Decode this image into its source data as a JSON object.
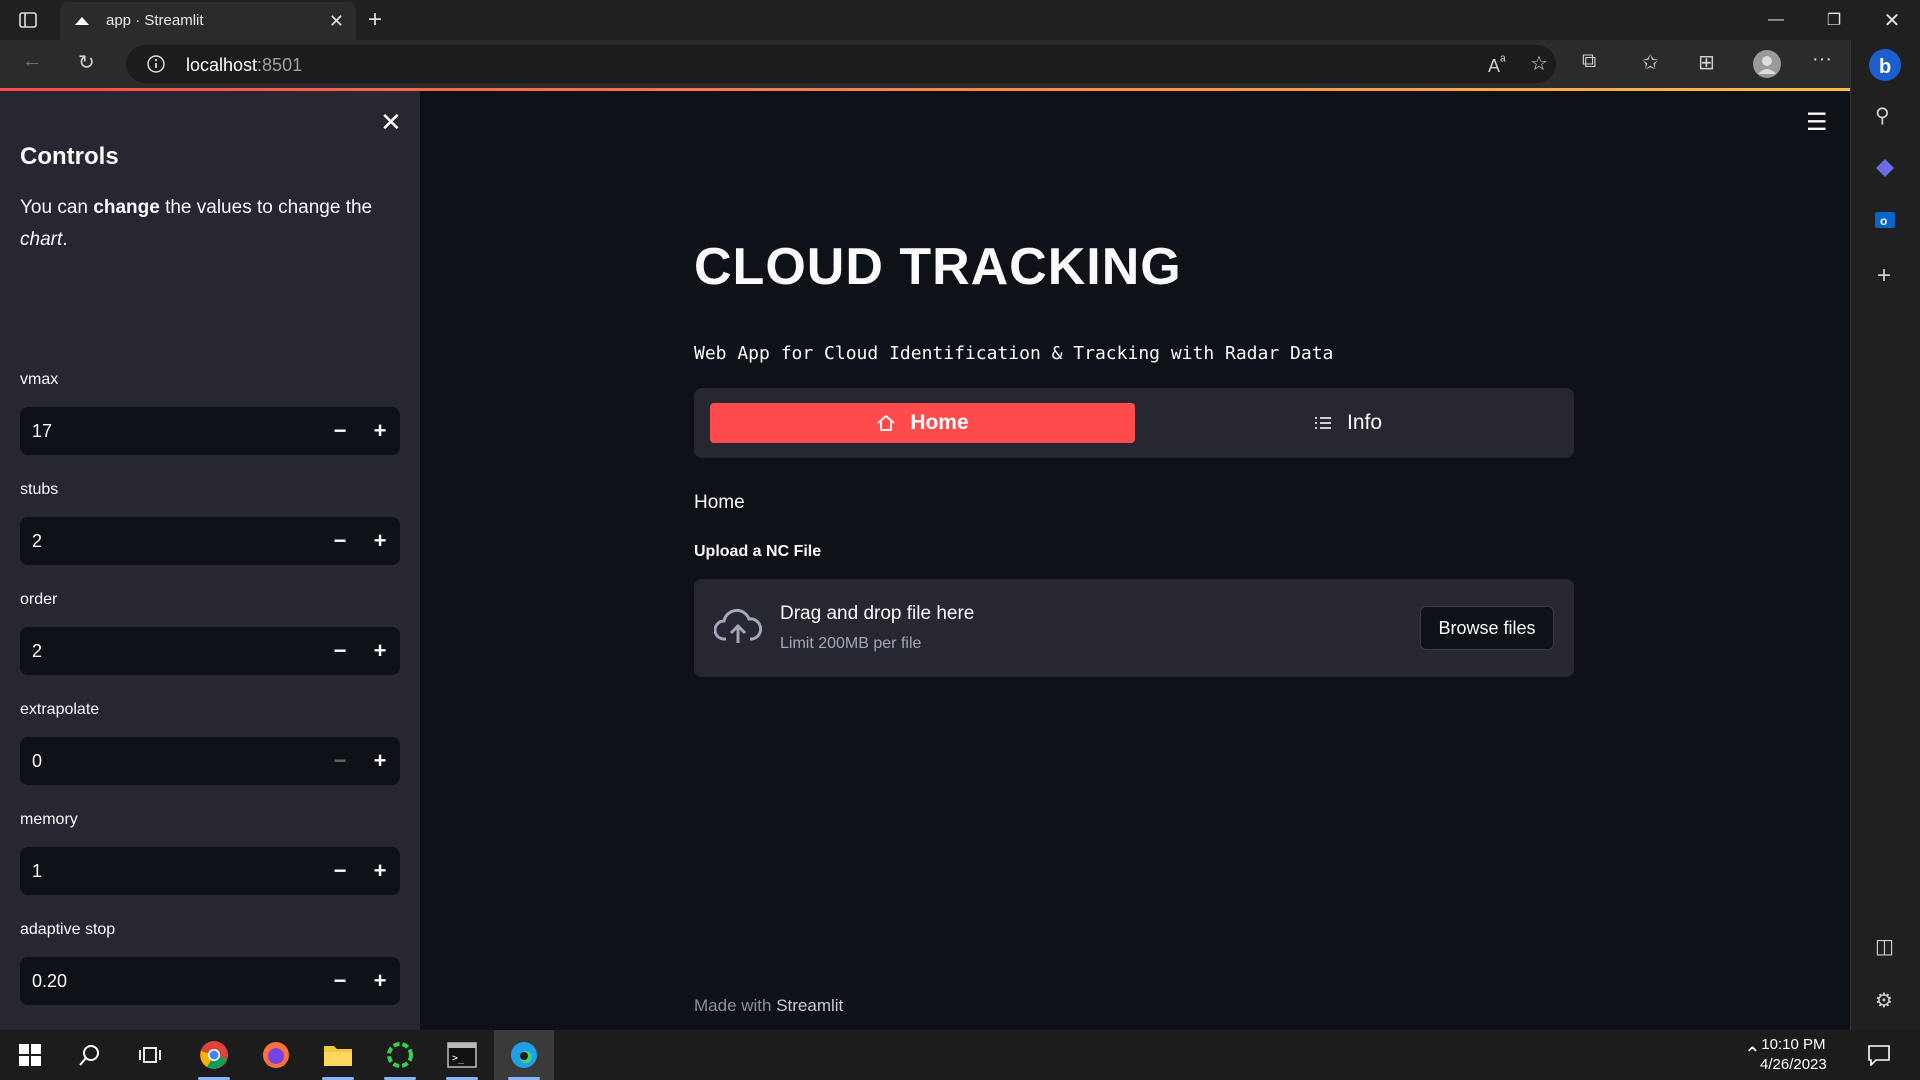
{
  "browser": {
    "tab_title": "app · Streamlit",
    "url_host": "localhost",
    "url_port": ":8501"
  },
  "sidebar": {
    "title": "Controls",
    "desc_prefix": "You can ",
    "desc_bold": "change",
    "desc_mid": " the values to change the ",
    "desc_italic": "chart",
    "desc_suffix": ".",
    "fields": [
      {
        "label": "vmax",
        "value": "17"
      },
      {
        "label": "stubs",
        "value": "2"
      },
      {
        "label": "order",
        "value": "2"
      },
      {
        "label": "extrapolate",
        "value": "0"
      },
      {
        "label": "memory",
        "value": "1"
      },
      {
        "label": "adaptive stop",
        "value": "0.20"
      }
    ]
  },
  "main": {
    "title": "CLOUD TRACKING",
    "subtitle": "Web App for Cloud Identification & Tracking with Radar Data",
    "nav": {
      "home": "Home",
      "info": "Info"
    },
    "section_text": "Home",
    "upload_label": "Upload a NC File",
    "drop_main": "Drag and drop file here",
    "drop_sub": "Limit 200MB per file",
    "browse_label": "Browse files",
    "footer_prefix": "Made with ",
    "footer_brand": "Streamlit"
  },
  "taskbar": {
    "time": "10:10 PM",
    "date": "4/26/2023"
  },
  "colors": {
    "accent": "#ff4b4b",
    "background": "#0e1117",
    "sidebar": "#262730"
  }
}
